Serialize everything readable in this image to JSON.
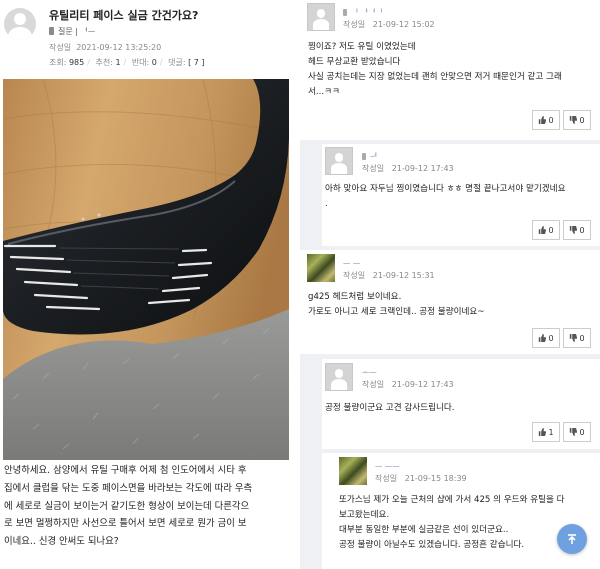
{
  "post": {
    "title": "유틸리티 페이스 실금 간건가요?",
    "author": "질문 | ᅥᅳ",
    "date_label": "작성일",
    "date": "2021-09-12 13:25:20",
    "stats": {
      "views_label": "조회:",
      "views": "985",
      "recommend_label": "추천:",
      "recommend": "1",
      "oppose_label": "반대:",
      "oppose": "0",
      "comments_label": "댓글:",
      "comments": "[ 7 ]"
    },
    "body_lines": [
      "안녕하세요. 삼양에서 유틸 구매후 어제 첨 인도어에서 시타 후",
      "집에서 클럽을 닦는 도중 페이스면을 바라보는 각도에 따라 우측",
      "에 세로로 실금이 보이는거 같기도한 형상이 보이는데 다른각으",
      "로 보면 멀쩡하지만 사선으로 틀어서 보면 세로로 뭔가 금이 보",
      "이네요.. 신경 안써도 되나요?"
    ]
  },
  "comments": [
    {
      "nick": "ᅵ ᅥᅥᅵ",
      "date_label": "작성일",
      "date": "21-09-12 15:02",
      "lines": [
        "찡이죠? 저도 유틸 이였었는데",
        "헤드 무상교환 받았습니다",
        "사실 공치는데는 지장 없었는데 괜히 안맞으면 저거 때문인거 같고 그래",
        "서...ㅋㅋ"
      ],
      "up": "0",
      "down": "0"
    },
    {
      "nick": "ᅳᅥ",
      "date_label": "작성일",
      "date": "21-09-12 17:43",
      "lines": [
        "아하 맞아요 자두님 찡이였습니다 ㅎㅎ 명절 끝나고서야 맡기겠네요",
        "."
      ],
      "up": "0",
      "down": "0"
    },
    {
      "nick": "ᅳ ᅳ",
      "date_label": "작성일",
      "date": "21-09-12 15:31",
      "lines": [
        "g425 헤드처럼 보이네요.",
        "가로도 아니고 세로 크랙인데.. 공정 불량이네요~"
      ],
      "up": "0",
      "down": "0"
    },
    {
      "nick": "ᅩᅳ",
      "date_label": "작성일",
      "date": "21-09-12 17:43",
      "lines": [
        "공정 불량이군요 고견 감사드립니다."
      ],
      "up": "1",
      "down": "0"
    },
    {
      "nick": "ᅳ ᅳᅳ",
      "date_label": "작성일",
      "date": "21-09-15 18:39",
      "lines": [
        "또가스님 제가 오늘 근처의 샵에 가서 425 의 우드와 유틸을 다",
        "보고왔는데요.",
        "대부분 동일한 부분에 실금같은 선이 있더군요..",
        "공정 불량이 아닐수도 있겠습니다.  공정흔 같습니다."
      ],
      "up": "",
      "down": ""
    }
  ],
  "icons": {
    "up": "thumbs-up-icon",
    "down": "thumbs-down-icon",
    "top": "arrow-up-icon"
  },
  "colors": {
    "nick": "#6b7fb0",
    "panel_bg": "#eef0f3",
    "top_button": "#6fa0e0"
  }
}
